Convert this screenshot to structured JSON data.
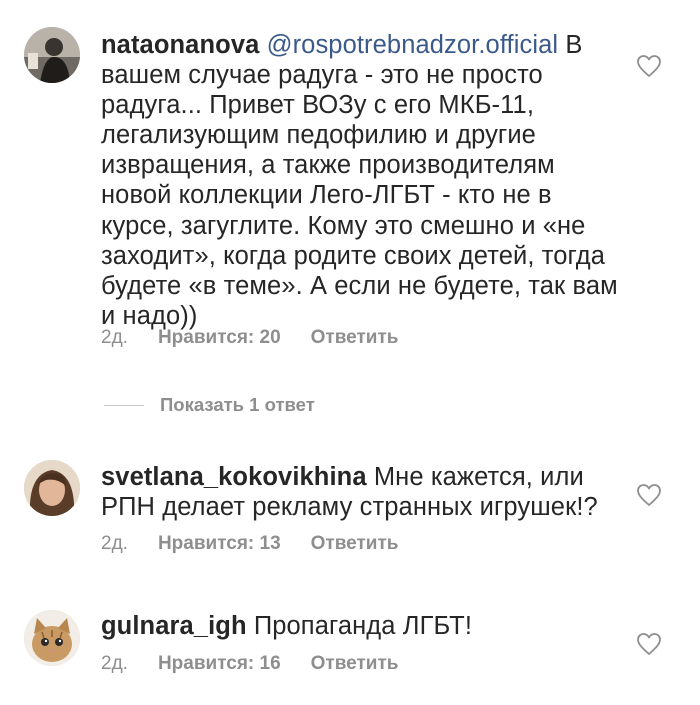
{
  "comments": [
    {
      "username": "nataonanova",
      "mention": "@rospotrebnadzor.official",
      "text": "В вашем случае радуга - это не просто радуга... Привет ВОЗу с его МКБ-11, легализующим педофилию и другие извращения, а также производителям новой коллекции Лего-ЛГБТ - кто не в курсе, загуглите. Кому это смешно и «не заходит», когда родите своих детей, тогда будете «в теме». А если не будете, так вам и надо))",
      "time": "2д.",
      "likes": "Нравится: 20",
      "reply": "Ответить",
      "avatar_icon": "user-photo-dark"
    },
    {
      "username": "svetlana_kokovikhina",
      "mention": "",
      "text": "Мне кажется, или РПН делает рекламу странных игрушек!?",
      "time": "2д.",
      "likes": "Нравится: 13",
      "reply": "Ответить",
      "avatar_icon": "user-photo-woman"
    },
    {
      "username": "gulnara_igh",
      "mention": "",
      "text": "Пропаганда ЛГБТ!",
      "time": "2д.",
      "likes": "Нравится: 16",
      "reply": "Ответить",
      "avatar_icon": "user-photo-kitten"
    }
  ],
  "show_replies_label": "Показать 1 ответ",
  "colors": {
    "text": "#262626",
    "secondary": "#8e8e8e",
    "mention": "#3b5a8a"
  }
}
